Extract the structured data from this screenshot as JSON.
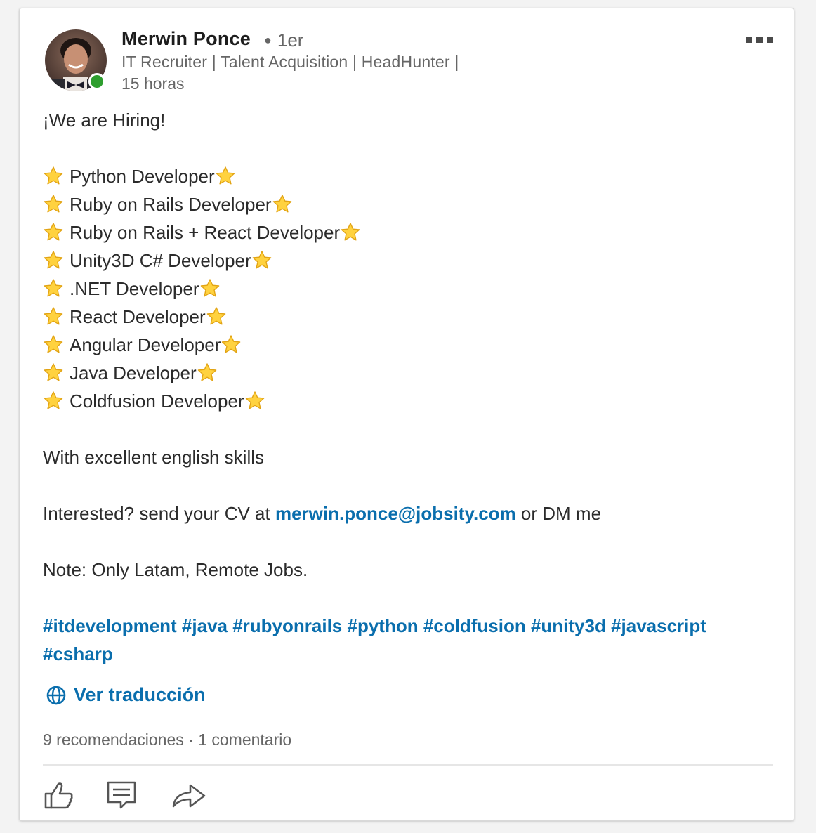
{
  "post": {
    "author": {
      "name": "Merwin Ponce",
      "degree": "1er",
      "headline": "IT Recruiter | Talent Acquisition | HeadHunter |",
      "time": "15 horas",
      "online": true
    },
    "intro": "¡We are Hiring!",
    "roles": [
      "Python Developer",
      "Ruby on Rails Developer",
      "Ruby on Rails + React Developer",
      "Unity3D C# Developer",
      ".NET Developer",
      "React Developer",
      "Angular Developer",
      "Java Developer",
      "Coldfusion Developer"
    ],
    "skills_line": "With excellent english skills",
    "contact_prefix": "Interested? send your CV at ",
    "contact_email": "merwin.ponce@jobsity.com",
    "contact_suffix": " or DM me",
    "note": "Note: Only Latam, Remote Jobs.",
    "hashtags_line1": "#itdevelopment #java #rubyonrails #python #coldfusion #unity3d #javascript",
    "hashtags_line2": "#csharp",
    "translate_label": "Ver traducción",
    "likes": "9 recomendaciones",
    "separator": "·",
    "comments": "1 comentario"
  },
  "actions": {
    "like_icon": "thumbs-up-icon",
    "comment_icon": "comment-icon",
    "share_icon": "share-icon"
  },
  "colors": {
    "link": "#0a6ead",
    "presence": "#2e9e2f",
    "text": "#2b2b2b",
    "muted": "#666666"
  }
}
